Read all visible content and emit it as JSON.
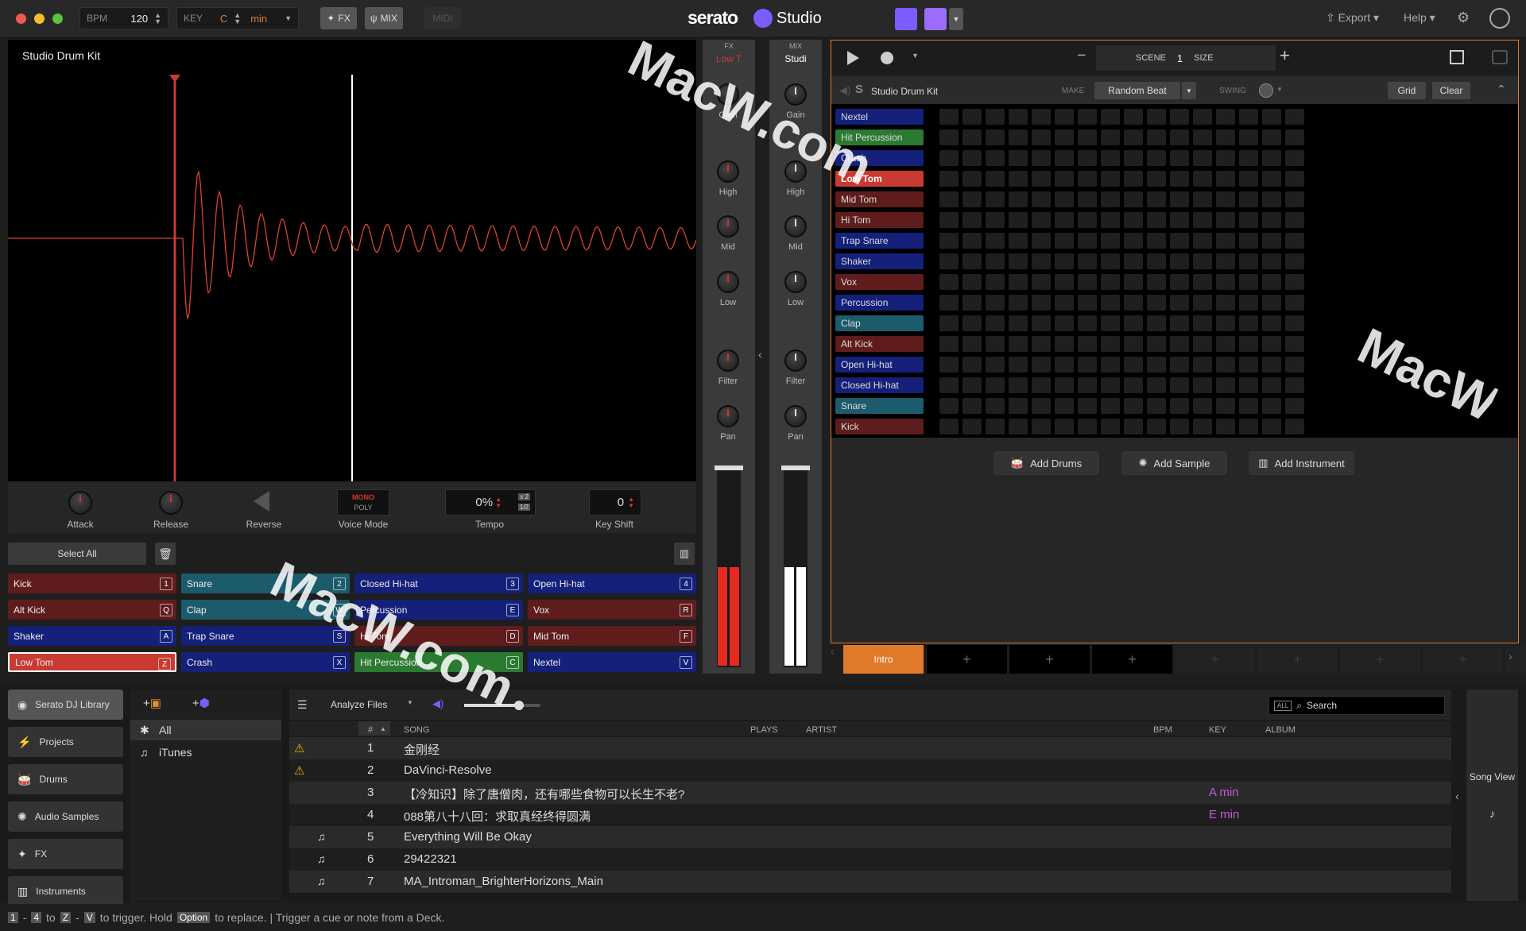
{
  "titlebar": {
    "bpm_label": "BPM",
    "bpm_value": "120",
    "key_label": "KEY",
    "key_value": "C",
    "key_scale": "min",
    "fx_label": "FX",
    "mix_label": "MIX",
    "midi_label": "MIDI",
    "brand": "serato",
    "product": "Studio",
    "export_label": "Export",
    "help_label": "Help"
  },
  "deck": {
    "title": "Studio Drum Kit",
    "controls": {
      "attack": "Attack",
      "release": "Release",
      "reverse": "Reverse",
      "voice_mode": "Voice Mode",
      "voice_mono": "MONO",
      "voice_poly": "POLY",
      "tempo_label": "Tempo",
      "tempo_value": "0%",
      "tempo_x2": "x 2",
      "tempo_half": "1/2",
      "keyshift_label": "Key Shift",
      "keyshift_value": "0"
    },
    "select_all": "Select All"
  },
  "pads": [
    {
      "label": "Kick",
      "key": "1",
      "color": "red"
    },
    {
      "label": "Snare",
      "key": "2",
      "color": "teal"
    },
    {
      "label": "Closed Hi-hat",
      "key": "3",
      "color": "blue"
    },
    {
      "label": "Open Hi-hat",
      "key": "4",
      "color": "blue"
    },
    {
      "label": "Alt Kick",
      "key": "Q",
      "color": "red"
    },
    {
      "label": "Clap",
      "key": "W",
      "color": "teal"
    },
    {
      "label": "Percussion",
      "key": "E",
      "color": "blue"
    },
    {
      "label": "Vox",
      "key": "R",
      "color": "red"
    },
    {
      "label": "Shaker",
      "key": "A",
      "color": "blue"
    },
    {
      "label": "Trap Snare",
      "key": "S",
      "color": "blue"
    },
    {
      "label": "Hi Tom",
      "key": "D",
      "color": "red"
    },
    {
      "label": "Mid Tom",
      "key": "F",
      "color": "red"
    },
    {
      "label": "Low Tom",
      "key": "Z",
      "color": "lt"
    },
    {
      "label": "Crash",
      "key": "X",
      "color": "blue"
    },
    {
      "label": "Hit Percussion",
      "key": "C",
      "color": "green"
    },
    {
      "label": "Nextel",
      "key": "V",
      "color": "blue"
    }
  ],
  "channels": {
    "ch1_top": "FX",
    "ch1_name": "Low T",
    "ch2_top": "MIX",
    "ch2_name": "Studi",
    "gain": "Gain",
    "high": "High",
    "mid": "Mid",
    "low": "Low",
    "filter": "Filter",
    "pan": "Pan"
  },
  "transport": {
    "scene_label": "SCENE",
    "scene_value": "1",
    "size_label": "SIZE"
  },
  "drum_machine": {
    "title": "Studio Drum Kit",
    "make_label": "MAKE",
    "make_value": "Random Beat",
    "swing_label": "SWING",
    "grid_label": "Grid",
    "clear_label": "Clear",
    "rows": [
      {
        "label": "Nextel",
        "color": "#14207a"
      },
      {
        "label": "Hit Percussion",
        "color": "#2b7a32"
      },
      {
        "label": "Crash",
        "color": "#14207a"
      },
      {
        "label": "Low Tom",
        "color": "#c93a32"
      },
      {
        "label": "Mid Tom",
        "color": "#5f1c1c"
      },
      {
        "label": "Hi Tom",
        "color": "#5f1c1c"
      },
      {
        "label": "Trap Snare",
        "color": "#14207a"
      },
      {
        "label": "Shaker",
        "color": "#14207a"
      },
      {
        "label": "Vox",
        "color": "#5f1c1c"
      },
      {
        "label": "Percussion",
        "color": "#14207a"
      },
      {
        "label": "Clap",
        "color": "#1c5b6b"
      },
      {
        "label": "Alt Kick",
        "color": "#5f1c1c"
      },
      {
        "label": "Open Hi-hat",
        "color": "#14207a"
      },
      {
        "label": "Closed Hi-hat",
        "color": "#14207a"
      },
      {
        "label": "Snare",
        "color": "#1c5b6b"
      },
      {
        "label": "Kick",
        "color": "#5f1c1c"
      }
    ],
    "add_drums": "Add Drums",
    "add_sample": "Add Sample",
    "add_instrument": "Add Instrument",
    "scene_intro": "Intro"
  },
  "library": {
    "sidebar": [
      "Serato DJ Library",
      "Projects",
      "Drums",
      "Audio Samples",
      "FX",
      "Instruments"
    ],
    "sources": [
      "All",
      "iTunes"
    ],
    "analyze": "Analyze Files",
    "all_toggle": "ALL",
    "search_placeholder": "Search",
    "columns": {
      "num": "#",
      "song": "SONG",
      "plays": "PLAYS",
      "artist": "ARTIST",
      "bpm": "BPM",
      "key": "KEY",
      "album": "ALBUM"
    },
    "rows": [
      {
        "num": "1",
        "song": "金刚经",
        "key": "",
        "warn": true,
        "note": false
      },
      {
        "num": "2",
        "song": "DaVinci-Resolve",
        "key": "",
        "warn": true,
        "note": false
      },
      {
        "num": "3",
        "song": "【冷知识】除了唐僧肉，还有哪些食物可以长生不老?",
        "key": "A min",
        "warn": false,
        "note": false
      },
      {
        "num": "4",
        "song": "088第八十八回：求取真经终得圆满",
        "key": "E min",
        "warn": false,
        "note": false
      },
      {
        "num": "5",
        "song": "Everything Will Be Okay",
        "key": "",
        "warn": false,
        "note": true
      },
      {
        "num": "6",
        "song": "29422321",
        "key": "",
        "warn": false,
        "note": true
      },
      {
        "num": "7",
        "song": "MA_Introman_BrighterHorizons_Main",
        "key": "",
        "warn": false,
        "note": true
      }
    ],
    "song_view": "Song View"
  },
  "status": {
    "k1": "1",
    "k4": "4",
    "kz": "Z",
    "kv": "V",
    "t1": "to trigger. Hold",
    "option": "Option",
    "t2": "to replace. | Trigger a cue or note from a Deck."
  },
  "watermark": "MacW.com",
  "colors": {
    "accent": "#e07a2a",
    "red": "#c93a32",
    "brand_purple": "#7a5cff"
  }
}
